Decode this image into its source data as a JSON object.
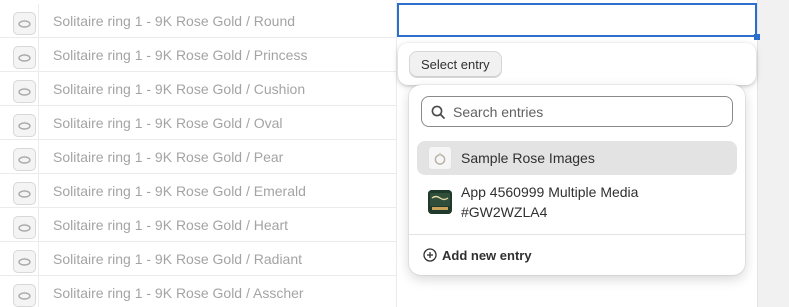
{
  "rows": [
    {
      "label": "Solitaire ring 1 - 9K Rose Gold / Round",
      "thumb_icon": "ring-thumbnail-icon"
    },
    {
      "label": "Solitaire ring 1 - 9K Rose Gold / Princess",
      "thumb_icon": "ring-thumbnail-icon"
    },
    {
      "label": "Solitaire ring 1 - 9K Rose Gold / Cushion",
      "thumb_icon": "ring-thumbnail-icon"
    },
    {
      "label": "Solitaire ring 1 - 9K Rose Gold / Oval",
      "thumb_icon": "ring-thumbnail-icon"
    },
    {
      "label": "Solitaire ring 1 - 9K Rose Gold / Pear",
      "thumb_icon": "ring-thumbnail-icon"
    },
    {
      "label": "Solitaire ring 1 - 9K Rose Gold / Emerald",
      "thumb_icon": "ring-thumbnail-icon"
    },
    {
      "label": "Solitaire ring 1 - 9K Rose Gold / Heart",
      "thumb_icon": "ring-thumbnail-icon"
    },
    {
      "label": "Solitaire ring 1 - 9K Rose Gold / Radiant",
      "thumb_icon": "ring-thumbnail-icon"
    },
    {
      "label": "Solitaire ring 1 - 9K Rose Gold / Asscher",
      "thumb_icon": "ring-thumbnail-icon"
    }
  ],
  "active_cell": {
    "value": ""
  },
  "popover": {
    "select_button_label": "Select entry"
  },
  "dropdown": {
    "search": {
      "placeholder": "Search entries",
      "value": "",
      "icon": "search-icon"
    },
    "options": [
      {
        "label": "Sample Rose Images",
        "icon": "ring-image-icon",
        "highlighted": true
      },
      {
        "label": "App 4560999 Multiple Media #GW2WZLA4",
        "icon": "media-thumbnail-icon",
        "highlighted": false
      }
    ],
    "add_entry_label": "Add new entry",
    "add_entry_icon": "plus-circle-icon"
  },
  "colors": {
    "accent": "#2c6ecb",
    "highlight": "#e3e3e3",
    "muted_text": "#9a9a9a"
  }
}
